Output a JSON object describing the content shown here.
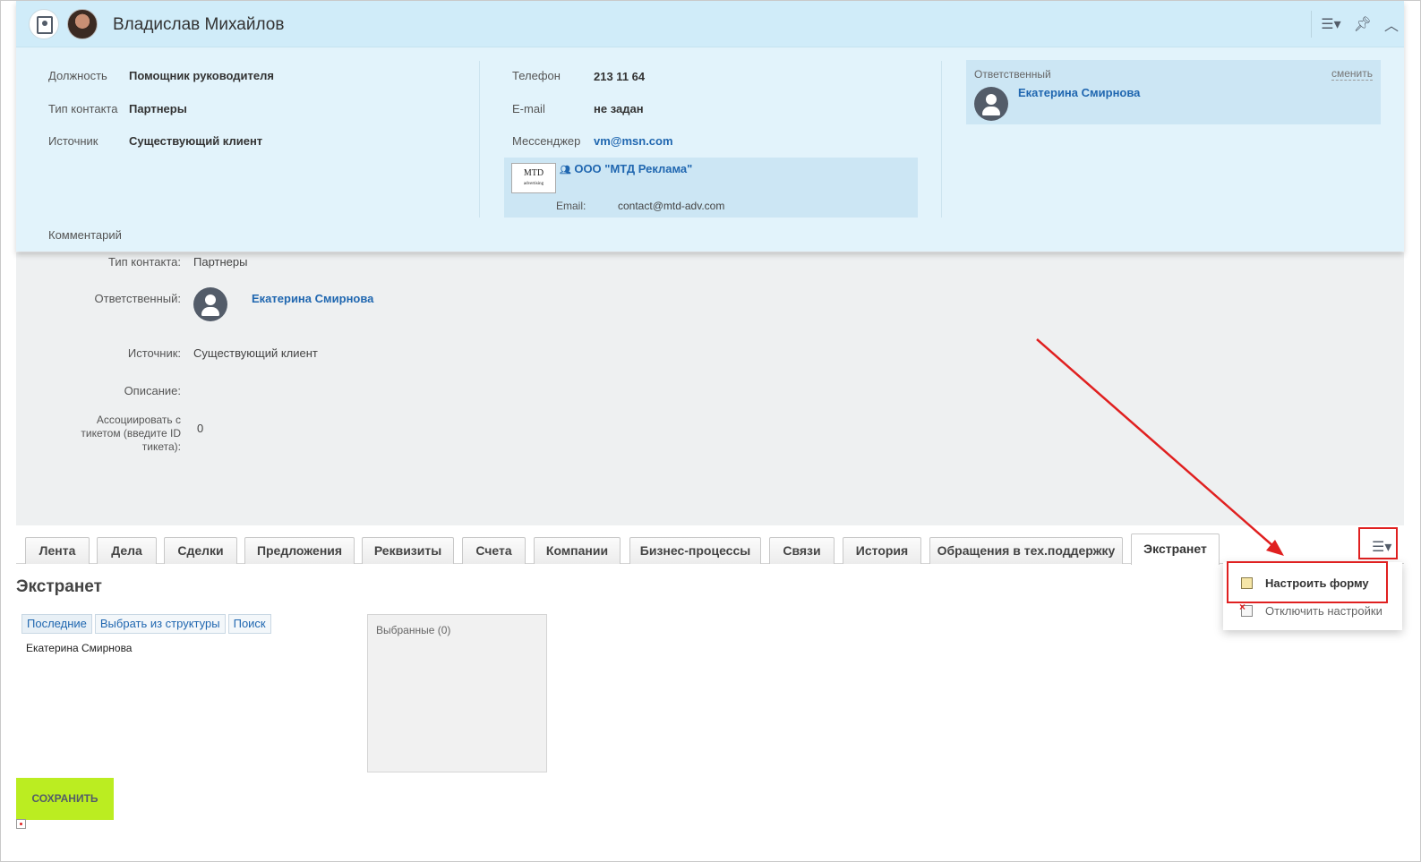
{
  "header": {
    "name": "Владислав Михайлов",
    "tools": [
      "list-settings-icon",
      "pin-icon",
      "collapse-icon"
    ]
  },
  "card": {
    "position_label": "Должность",
    "position_value": "Помощник руководителя",
    "contact_type_label": "Тип контакта",
    "contact_type_value": "Партнеры",
    "source_label": "Источник",
    "source_value": "Существующий клиент",
    "comment_label": "Комментарий",
    "phone_label": "Телефон",
    "phone_value": "213 11 64",
    "email_label": "E-mail",
    "email_value": "не задан",
    "messenger_label": "Мессенджер",
    "messenger_value": "vm@msn.com",
    "company": {
      "logo_text": "MTD",
      "logo_sub": "advertising",
      "name": "ООО \"МТД Реклама\"",
      "email_label": "Email:",
      "email_value": "contact@mtd-adv.com"
    },
    "responsible": {
      "label": "Ответственный",
      "change": "сменить",
      "name": "Екатерина Смирнова"
    }
  },
  "form": {
    "contact_type_label": "Тип контакта:",
    "contact_type_value": "Партнеры",
    "responsible_label": "Ответственный:",
    "responsible_value": "Екатерина Смирнова",
    "source_label": "Источник:",
    "source_value": "Существующий клиент",
    "description_label": "Описание:",
    "ticket_label_1": "Ассоциировать с",
    "ticket_label_2": "тикетом (введите ID",
    "ticket_label_3": "тикета):",
    "ticket_value": "0"
  },
  "tabs": [
    {
      "label": "Лента"
    },
    {
      "label": "Дела"
    },
    {
      "label": "Сделки"
    },
    {
      "label": "Предложения"
    },
    {
      "label": "Реквизиты"
    },
    {
      "label": "Счета"
    },
    {
      "label": "Компании"
    },
    {
      "label": "Бизнес-процессы"
    },
    {
      "label": "Связи"
    },
    {
      "label": "История"
    },
    {
      "label": "Обращения в тех.поддержку"
    },
    {
      "label": "Экстранет"
    }
  ],
  "active_tab": "Экстранет",
  "menu": {
    "items": [
      {
        "label": "Настроить форму"
      },
      {
        "label": "Отключить настройки"
      }
    ]
  },
  "extranet": {
    "title": "Экстранет",
    "subtabs": [
      "Последние",
      "Выбрать из структуры",
      "Поиск"
    ],
    "person": "Екатерина Смирнова",
    "selected": "Выбранные (0)"
  },
  "save_button": "СОХРАНИТЬ",
  "colors": {
    "card_bg": "#e2f3fb",
    "link": "#2067b0",
    "save_bg": "#bbed21",
    "highlight": "#e02020"
  }
}
